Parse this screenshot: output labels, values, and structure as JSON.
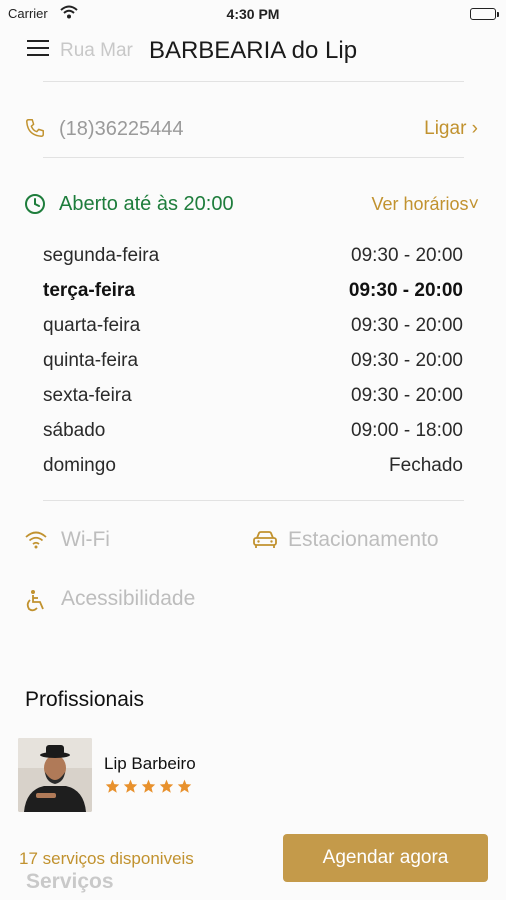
{
  "statusbar": {
    "carrier": "Carrier",
    "time": "4:30 PM"
  },
  "navbar": {
    "title": "BARBEARIA do Lip",
    "address_preview": "Rua Mar"
  },
  "contact": {
    "phone": "(18)36225444",
    "call_label": "Ligar ›"
  },
  "hours": {
    "status": "Aberto até às 20:00",
    "toggle_label": "Ver horários˅",
    "days": [
      {
        "day": "segunda-feira",
        "hours": "09:30 - 20:00"
      },
      {
        "day": "terça-feira",
        "hours": "09:30 - 20:00"
      },
      {
        "day": "quarta-feira",
        "hours": "09:30 - 20:00"
      },
      {
        "day": "quinta-feira",
        "hours": "09:30 - 20:00"
      },
      {
        "day": "sexta-feira",
        "hours": "09:30 - 20:00"
      },
      {
        "day": "sábado",
        "hours": "09:00 - 18:00"
      },
      {
        "day": "domingo",
        "hours": "Fechado"
      }
    ]
  },
  "amenities": {
    "wifi": "Wi-Fi",
    "parking": "Estacionamento",
    "accessibility": "Acessibilidade"
  },
  "professionals": {
    "title": "Profissionais",
    "items": [
      {
        "name": "Lip Barbeiro",
        "rating": 5
      }
    ]
  },
  "footer": {
    "services_count": "17 serviços disponiveis",
    "services_tab": "Serviços",
    "book_label": "Agendar agora"
  },
  "colors": {
    "accent": "#c1922f",
    "open": "#1e7d3c",
    "button": "#c49a4a",
    "star": "#e8912d"
  }
}
